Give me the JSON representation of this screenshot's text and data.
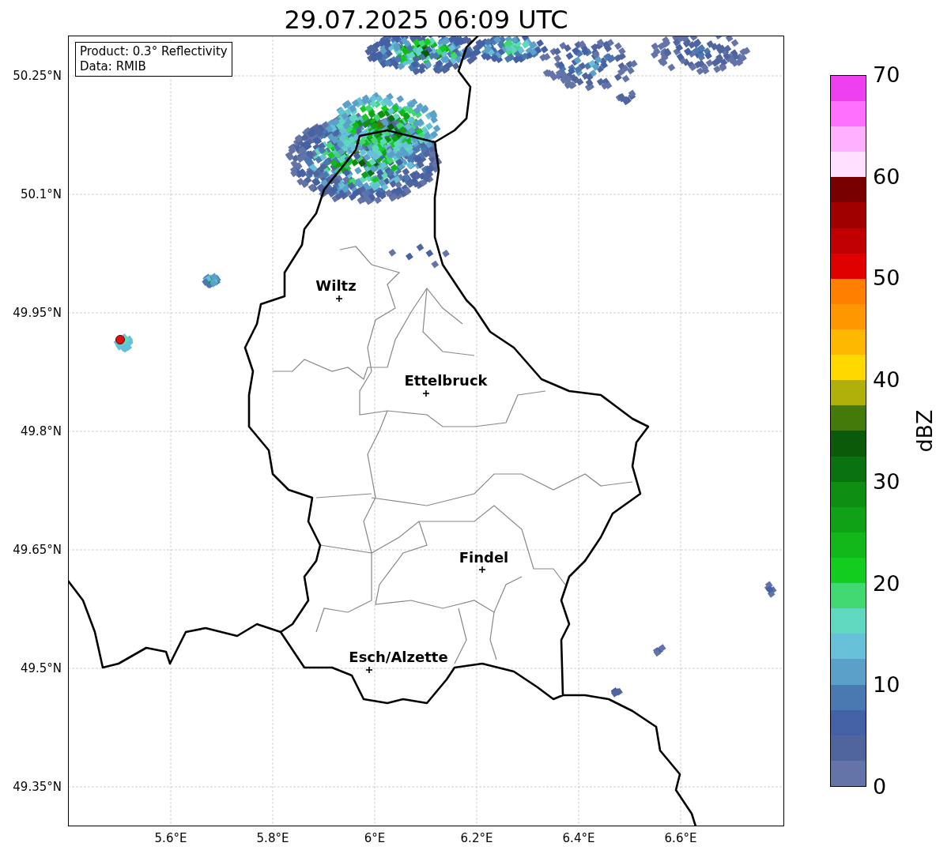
{
  "title": "29.07.2025 06:09 UTC",
  "info_box": {
    "lines": [
      "Product: 0.3° Reflectivity",
      "Data: RMIB"
    ]
  },
  "map": {
    "lat_labels": [
      "50.25°N",
      "50.1°N",
      "49.95°N",
      "49.8°N",
      "49.65°N",
      "49.5°N",
      "49.35°N"
    ],
    "lon_labels": [
      "5.6°E",
      "5.8°E",
      "6°E",
      "6.2°E",
      "6.4°E",
      "6.6°E"
    ],
    "cities": [
      {
        "name": "Wiltz"
      },
      {
        "name": "Ettelbruck"
      },
      {
        "name": "Findel"
      },
      {
        "name": "Esch/Alzette"
      }
    ]
  },
  "colorbar": {
    "label": "dBZ",
    "ticks": [
      "70",
      "60",
      "50",
      "40",
      "30",
      "20",
      "10",
      "0"
    ],
    "bins": [
      {
        "color": "#6474a8"
      },
      {
        "color": "#50649e"
      },
      {
        "color": "#4461a5"
      },
      {
        "color": "#4a78b0"
      },
      {
        "color": "#5aa0c8"
      },
      {
        "color": "#66c0d8"
      },
      {
        "color": "#60d8c0"
      },
      {
        "color": "#40d870"
      },
      {
        "color": "#12cc1e"
      },
      {
        "color": "#12b81a"
      },
      {
        "color": "#10a216"
      },
      {
        "color": "#0e8e12"
      },
      {
        "color": "#0a720e"
      },
      {
        "color": "#0a5a0a"
      },
      {
        "color": "#447a0a"
      },
      {
        "color": "#b0b00a"
      },
      {
        "color": "#ffd800"
      },
      {
        "color": "#ffb800"
      },
      {
        "color": "#ff9800"
      },
      {
        "color": "#ff8000"
      },
      {
        "color": "#e00000"
      },
      {
        "color": "#c00000"
      },
      {
        "color": "#a00000"
      },
      {
        "color": "#780000"
      },
      {
        "color": "#ffe0ff"
      },
      {
        "color": "#ffb0ff"
      },
      {
        "color": "#ff70ff"
      },
      {
        "color": "#ee40ee"
      }
    ]
  }
}
